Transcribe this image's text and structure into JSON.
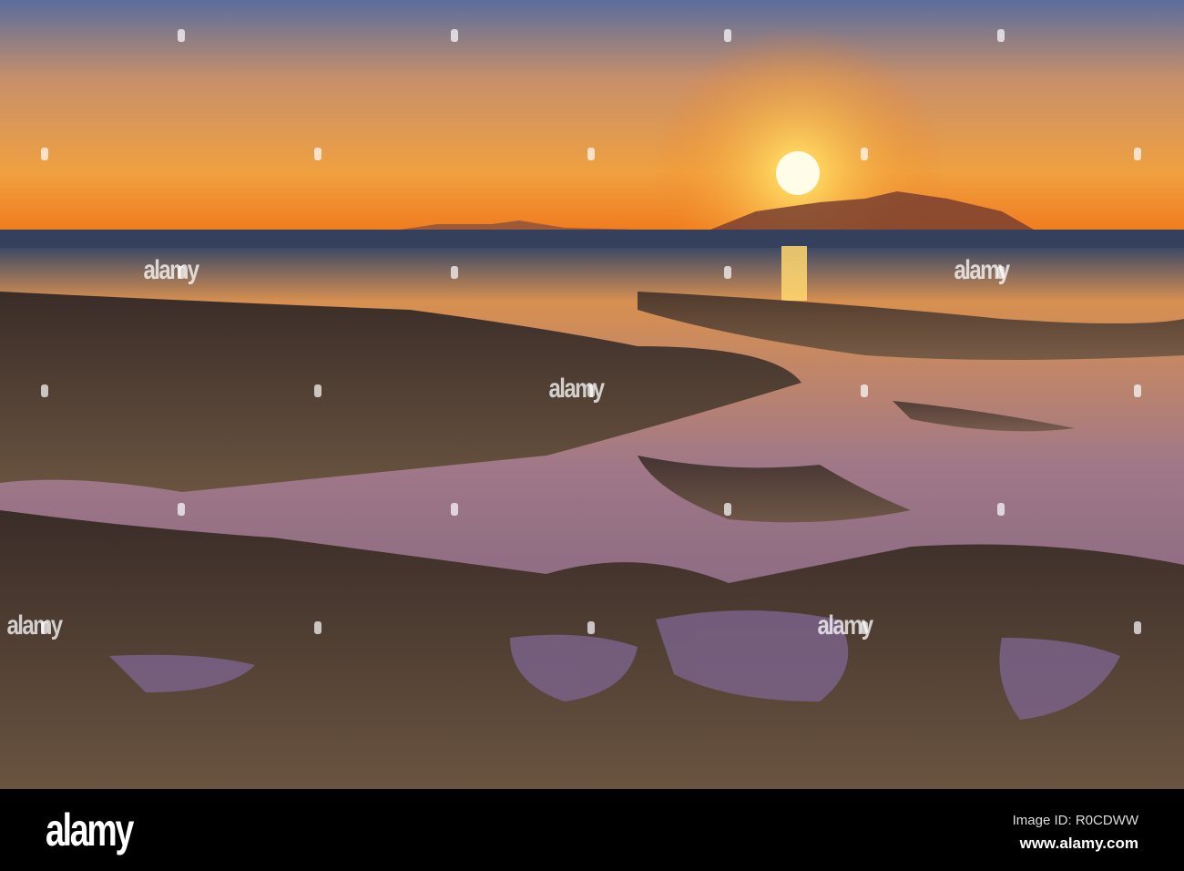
{
  "photo": {
    "subject": "sunset over low-tide reef",
    "colors": {
      "sky_top": "#5a6d9c",
      "sky_mid": "#e89a45",
      "horizon": "#f07d20",
      "sun": "#fff8d0",
      "water": "#8c6f8c",
      "rock": "#4a3c30"
    }
  },
  "watermark": {
    "text": "alamy"
  },
  "footer": {
    "logo": "alamy",
    "image_id": "Image ID: R0CDWW",
    "website": "www.alamy.com"
  }
}
